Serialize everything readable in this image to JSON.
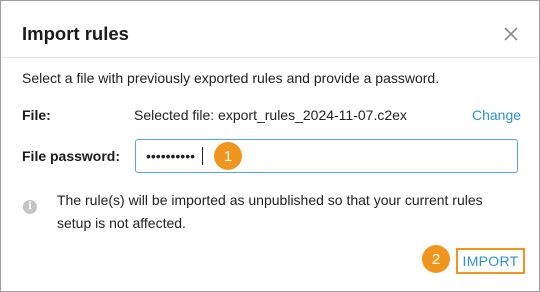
{
  "dialog": {
    "title": "Import rules",
    "intro": "Select a file with previously exported rules and provide a password.",
    "file": {
      "label": "File:",
      "value": "Selected file: export_rules_2024-11-07.c2ex",
      "change_label": "Change"
    },
    "password": {
      "label": "File password:",
      "value": "••••••••••"
    },
    "info": "The rule(s) will be imported as unpublished so that your current rules setup is not affected.",
    "import_label": "IMPORT",
    "badges": [
      "1",
      "2"
    ],
    "colors": {
      "accent": "#2f8fd3",
      "badge": "#f0961f",
      "input_border": "#5aa7e0"
    },
    "icons": {
      "close": "close-icon",
      "info": "info-icon"
    }
  }
}
